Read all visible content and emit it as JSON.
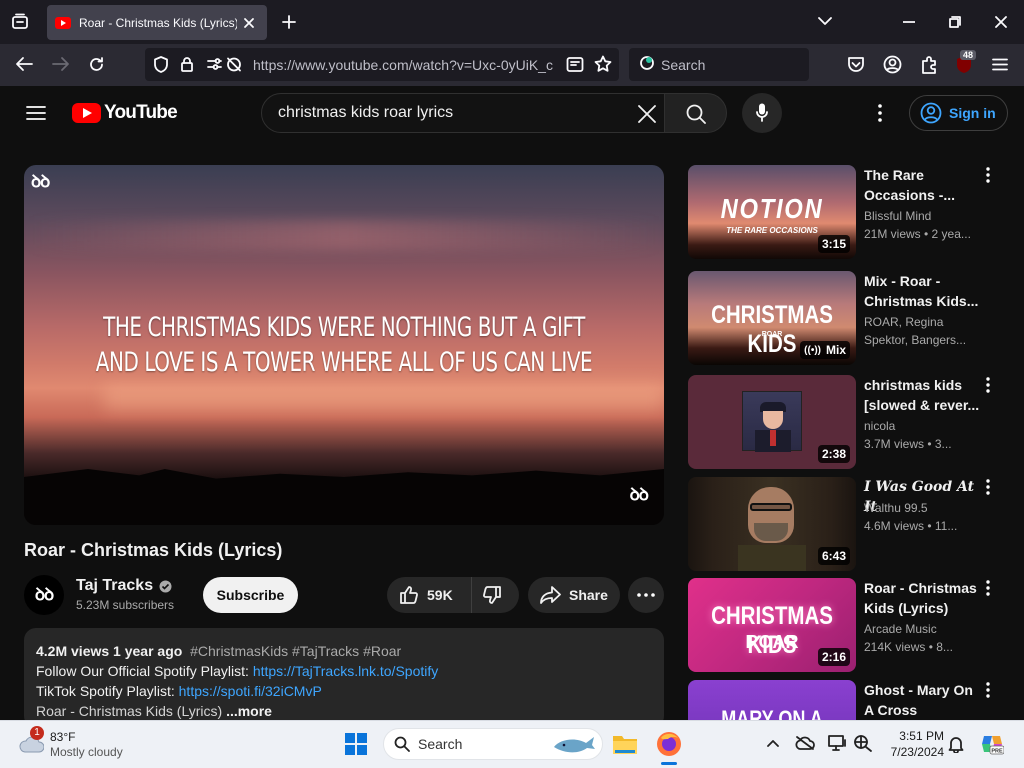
{
  "browser": {
    "tab_title": "Roar - Christmas Kids (Lyrics) -",
    "url": "https://www.youtube.com/watch?v=Uxc-0yUiK_c",
    "search_placeholder": "Search",
    "extension_badge": "48"
  },
  "youtube": {
    "logo_text": "YouTube",
    "search_query": "christmas kids roar lyrics",
    "signin_label": "Sign in",
    "accent": "#3ea6ff"
  },
  "video": {
    "lyrics_line1": "THE CHRISTMAS KIDS WERE NOTHING BUT A GIFT",
    "lyrics_line2": "AND LOVE IS A TOWER WHERE ALL OF US CAN LIVE",
    "watermark": "ꝺꝺ",
    "title": "Roar - Christmas Kids (Lyrics)",
    "channel": "Taj Tracks",
    "subscribers": "5.23M subscribers",
    "subscribe_label": "Subscribe",
    "likes": "59K",
    "share_label": "Share"
  },
  "description": {
    "stats": "4.2M views  1 year ago",
    "tags": "#ChristmasKids #TajTracks #Roar",
    "line1_text": "Follow Our Official Spotify Playlist: ",
    "line1_link": "https://TajTracks.lnk.to/Spotify",
    "line2_text": "TikTok Spotify Playlist: ",
    "line2_link": "https://spoti.fi/32iCMvP",
    "line3_text": "Roar - Christmas Kids (Lyrics)",
    "more": "...more"
  },
  "recommendations": [
    {
      "title": "The Rare Occasions -...",
      "channel": "Blissful Mind",
      "meta": "21M views  • 2 yea...",
      "duration": "3:15",
      "thumb_text": "NOTION",
      "thumb_sub": "THE RARE OCCASIONS"
    },
    {
      "title": "Mix - Roar - Christmas Kids...",
      "channel": "ROAR, Regina",
      "meta": "Spektor, Bangers...",
      "duration": "Mix",
      "thumb_text": "CHRISTMAS KIDS",
      "thumb_sub": "ROAR"
    },
    {
      "title": "christmas kids [slowed & rever...",
      "channel": "nicola",
      "meta": "3.7M views  • 3...",
      "duration": "2:38"
    },
    {
      "title": "I Was Good At It",
      "channel": "Walthu 99.5",
      "meta": "4.6M views  • 11...",
      "duration": "6:43"
    },
    {
      "title": "Roar - Christmas Kids (Lyrics)",
      "channel": "Arcade Music",
      "meta": "214K views  • 8...",
      "duration": "2:16",
      "thumb_text": "CHRISTMAS KIDS",
      "thumb_sub": "ROAR"
    },
    {
      "title": "Ghost - Mary On A Cross",
      "thumb_text": "MARY ON A CROSS"
    }
  ],
  "taskbar": {
    "temp": "83°F",
    "condition": "Mostly cloudy",
    "weather_badge": "1",
    "search_label": "Search",
    "time": "3:51 PM",
    "date": "7/23/2024"
  }
}
